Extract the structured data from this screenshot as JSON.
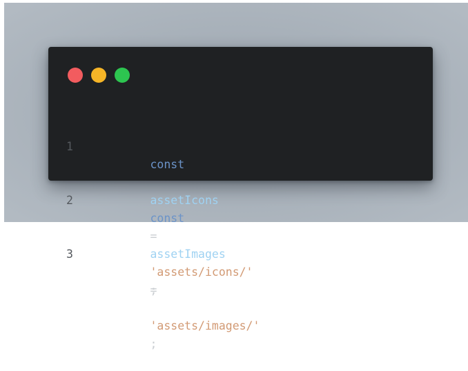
{
  "colors": {
    "window_bg": "#1f2123",
    "close": "#f25c5f",
    "minimize": "#f6b527",
    "maximize": "#2dc550",
    "line_number": "#55595e",
    "keyword": "#6b93c8",
    "identifier": "#9fd2f2",
    "operator": "#c9cdd1",
    "string": "#d29a74",
    "punctuation": "#c9cdd1"
  },
  "window_controls": [
    {
      "name": "close-button",
      "color": "#f25c5f"
    },
    {
      "name": "minimize-button",
      "color": "#f6b527"
    },
    {
      "name": "maximize-button",
      "color": "#2dc550"
    }
  ],
  "code": {
    "lines": [
      {
        "number": "1",
        "keyword": "const",
        "identifier": "assetIcons",
        "operator": "=",
        "string": "'assets/icons/'",
        "punct": ";"
      },
      {
        "number": "2",
        "keyword": "const",
        "identifier": "assetImages",
        "operator": "=",
        "string": "'assets/images/'",
        "punct": ";"
      },
      {
        "number": "3",
        "keyword": "",
        "identifier": "",
        "operator": "",
        "string": "",
        "punct": ""
      }
    ]
  }
}
